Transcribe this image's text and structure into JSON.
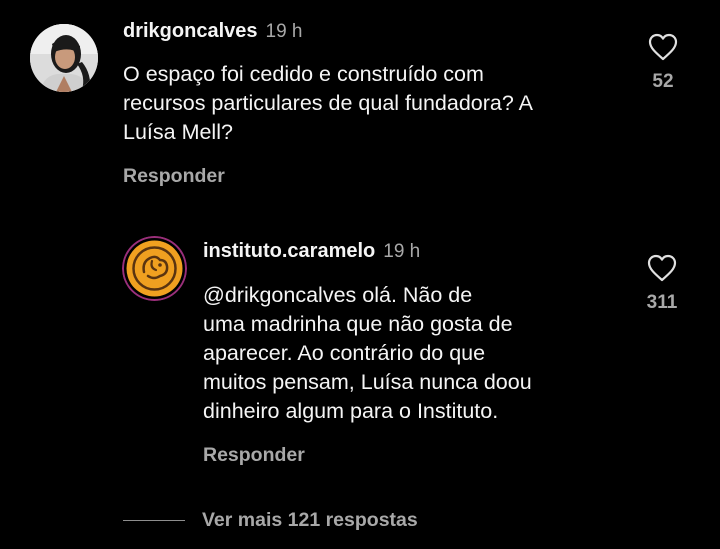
{
  "comments": [
    {
      "username": "drikgoncalves",
      "time": "19 h",
      "text": "O espaço foi cedido e construído com\nrecursos particulares de qual fundadora? A\nLuísa Mell?",
      "reply_label": "Responder",
      "likes": "52",
      "avatar_icon": "user-photo-avatar"
    },
    {
      "username": "instituto.caramelo",
      "time": "19 h",
      "text": "@drikgoncalves olá. Não de\numa madrinha que não gosta de\naparecer. Ao contrário do que\nmuitos pensam, Luísa nunca doou\ndinheiro algum para o Instituto.",
      "reply_label": "Responder",
      "likes": "311",
      "avatar_icon": "caramelo-dog-logo"
    }
  ],
  "more_replies_label": "Ver mais 121 respostas",
  "icons": {
    "like": "heart-outline-icon"
  },
  "colors": {
    "background": "#000000",
    "primary_text": "#f5f5f5",
    "secondary_text": "#a8a8a8",
    "logo_orange": "#f0a020"
  }
}
